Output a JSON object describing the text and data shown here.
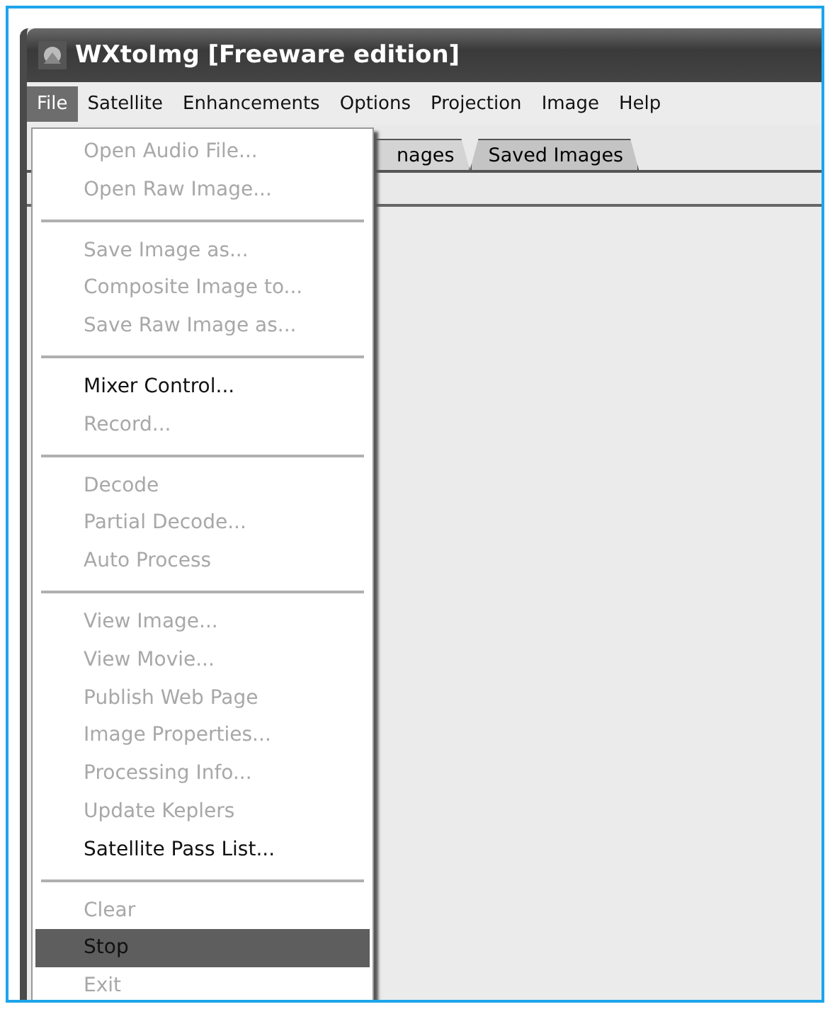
{
  "window": {
    "title": "WXtoImg [Freeware edition]"
  },
  "menu_bar": [
    {
      "label": "File",
      "selected": true
    },
    {
      "label": "Satellite",
      "selected": false
    },
    {
      "label": "Enhancements",
      "selected": false
    },
    {
      "label": "Options",
      "selected": false
    },
    {
      "label": "Projection",
      "selected": false
    },
    {
      "label": "Image",
      "selected": false
    },
    {
      "label": "Help",
      "selected": false
    }
  ],
  "tabs": [
    {
      "label": "nages",
      "selected": false
    },
    {
      "label": "Saved Images",
      "selected": true
    }
  ],
  "file_menu": {
    "groups": [
      {
        "items": [
          {
            "label": "Open Audio File...",
            "disabled": true,
            "selected": false
          },
          {
            "label": "Open Raw Image...",
            "disabled": true,
            "selected": false
          }
        ]
      },
      {
        "items": [
          {
            "label": "Save Image as...",
            "disabled": true,
            "selected": false
          },
          {
            "label": "Composite Image to...",
            "disabled": true,
            "selected": false
          },
          {
            "label": "Save Raw Image as...",
            "disabled": true,
            "selected": false
          }
        ]
      },
      {
        "items": [
          {
            "label": "Mixer Control...",
            "disabled": false,
            "selected": false
          },
          {
            "label": "Record...",
            "disabled": true,
            "selected": false
          }
        ]
      },
      {
        "items": [
          {
            "label": "Decode",
            "disabled": true,
            "selected": false
          },
          {
            "label": "Partial Decode...",
            "disabled": true,
            "selected": false
          },
          {
            "label": "Auto Process",
            "disabled": true,
            "selected": false
          }
        ]
      },
      {
        "items": [
          {
            "label": "View Image...",
            "disabled": true,
            "selected": false
          },
          {
            "label": "View Movie...",
            "disabled": true,
            "selected": false
          },
          {
            "label": "Publish Web Page",
            "disabled": true,
            "selected": false
          },
          {
            "label": "Image Properties...",
            "disabled": true,
            "selected": false
          },
          {
            "label": "Processing Info...",
            "disabled": true,
            "selected": false
          },
          {
            "label": "Update Keplers",
            "disabled": true,
            "selected": false
          },
          {
            "label": "Satellite Pass List...",
            "disabled": false,
            "selected": false
          }
        ]
      },
      {
        "items": [
          {
            "label": "Clear",
            "disabled": true,
            "selected": false
          },
          {
            "label": "Stop",
            "disabled": false,
            "selected": true
          },
          {
            "label": "Exit",
            "disabled": true,
            "selected": false
          }
        ]
      }
    ]
  }
}
